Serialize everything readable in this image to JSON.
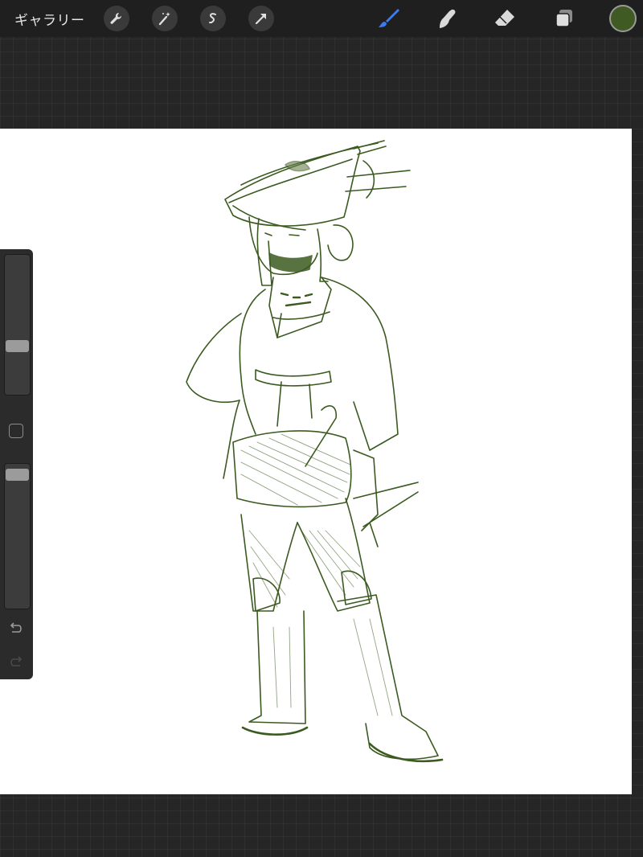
{
  "topbar": {
    "gallery_label": "ギャラリー",
    "left_tools": [
      "wrench-icon",
      "magic-wand-icon",
      "selection-icon",
      "transform-arrow-icon"
    ],
    "right_tools": [
      "brush-icon",
      "smudge-icon",
      "eraser-icon",
      "layers-icon"
    ],
    "active_tool": "brush",
    "active_tool_color": "#3d7bf0",
    "current_color": "#3f5b23"
  },
  "sidebar": {
    "brush_size_level": 0.4,
    "opacity_level": 0.97,
    "icons": [
      "brush-size-slider",
      "modify-button-icon",
      "opacity-slider",
      "undo-icon",
      "redo-icon"
    ]
  },
  "canvas": {
    "stroke_color": "#3b5a1f",
    "background": "#ffffff"
  }
}
